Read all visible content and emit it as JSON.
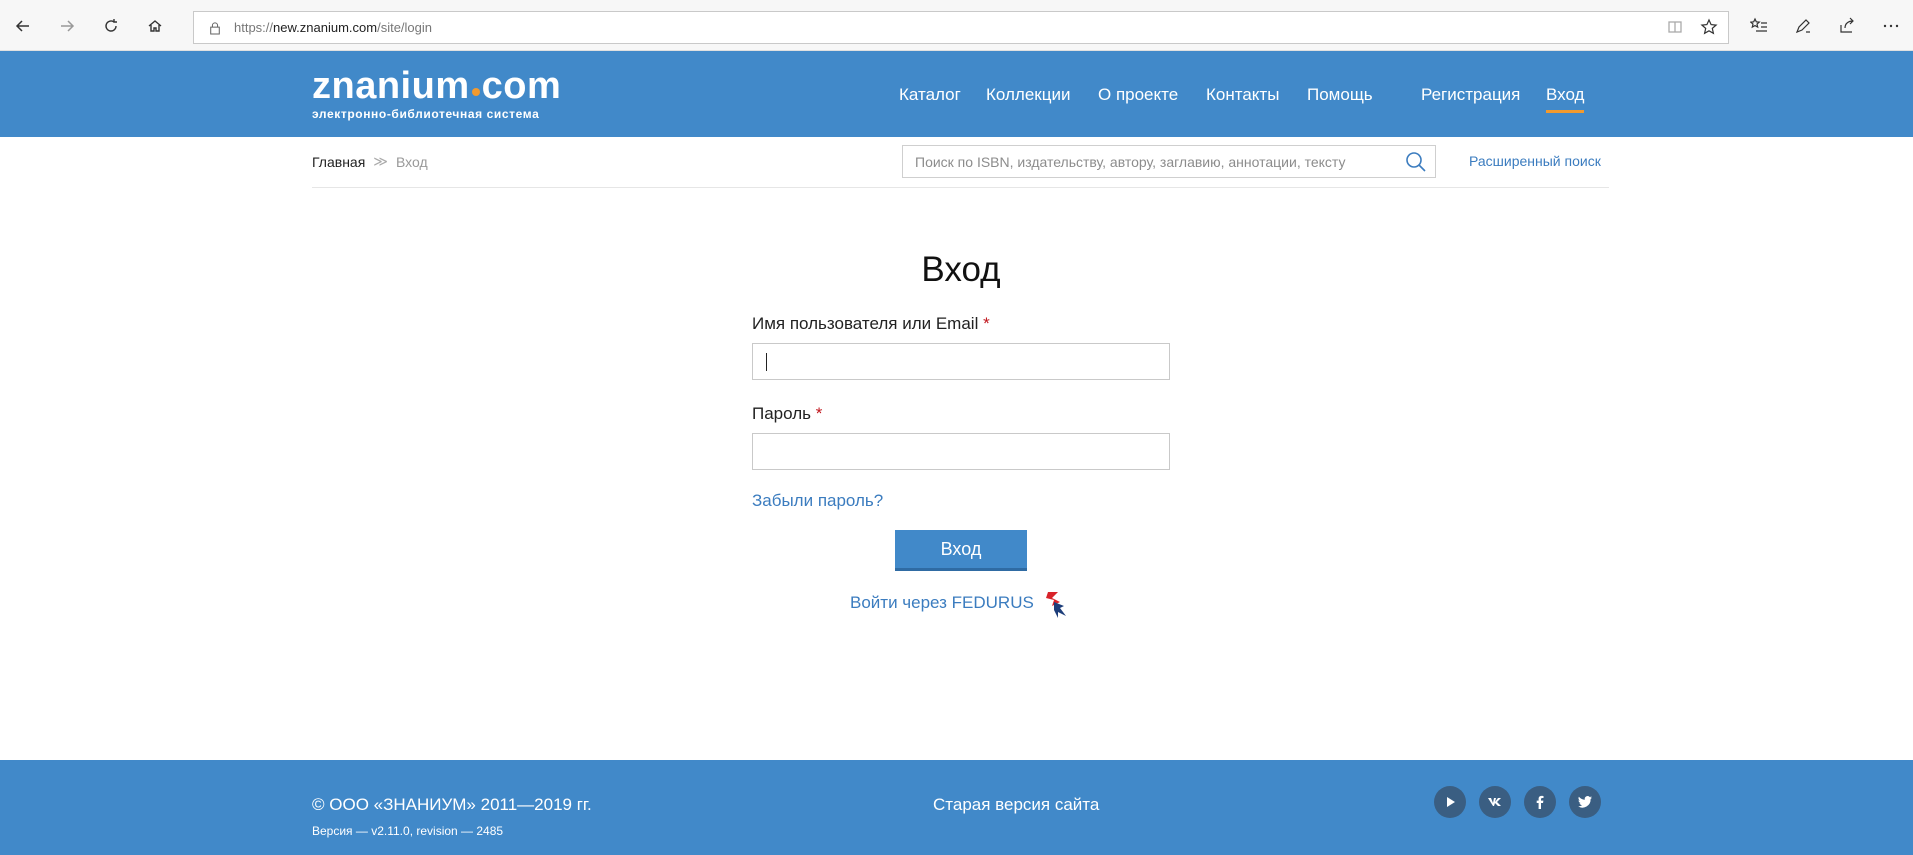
{
  "browser": {
    "url_prefix": "https://",
    "url_host": "new.znanium.com",
    "url_path": "/site/login"
  },
  "header": {
    "logo_name_left": "znanium",
    "logo_name_right": "com",
    "logo_tagline": "электронно-библиотечная система",
    "nav": [
      "Каталог",
      "Коллекции",
      "О проекте",
      "Контакты",
      "Помощь"
    ],
    "register_label": "Регистрация",
    "login_label": "Вход"
  },
  "breadcrumb": {
    "home": "Главная",
    "separator": "≫",
    "current": "Вход"
  },
  "search": {
    "placeholder": "Поиск по ISBN, издательству, автору, заглавию, аннотации, тексту",
    "advanced_label": "Расширенный поиск"
  },
  "login_form": {
    "title": "Вход",
    "username_label": "Имя пользователя или Email",
    "username_value": "",
    "password_label": "Пароль",
    "password_value": "",
    "required_mark": "*",
    "forgot_label": "Забыли пароль?",
    "submit_label": "Вход",
    "fedurus_label": "Войти через FEDURUS"
  },
  "footer": {
    "copyright": "© ООО «ЗНАНИУМ» 2011—2019 гг.",
    "version": "Версия — v2.11.0, revision — 2485",
    "old_site_label": "Старая версия сайта",
    "social": [
      "youtube-icon",
      "vk-icon",
      "facebook-icon",
      "twitter-icon"
    ]
  },
  "colors": {
    "brand_blue": "#4189c9",
    "accent_orange": "#f29a2e",
    "link_blue": "#3b7cbf",
    "required_red": "#c0141b"
  }
}
